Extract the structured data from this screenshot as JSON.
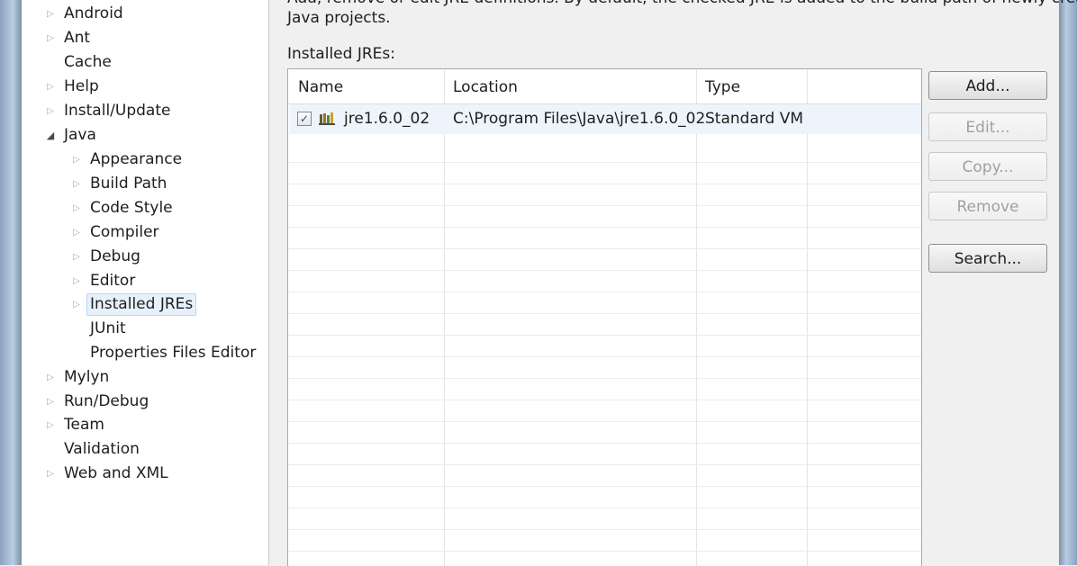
{
  "tree": {
    "items": [
      {
        "label": "Android",
        "expander": "collapsed"
      },
      {
        "label": "Ant",
        "expander": "collapsed"
      },
      {
        "label": "Cache",
        "expander": "none"
      },
      {
        "label": "Help",
        "expander": "collapsed"
      },
      {
        "label": "Install/Update",
        "expander": "collapsed"
      },
      {
        "label": "Java",
        "expander": "expanded"
      },
      {
        "label": "Appearance",
        "expander": "collapsed"
      },
      {
        "label": "Build Path",
        "expander": "collapsed"
      },
      {
        "label": "Code Style",
        "expander": "collapsed"
      },
      {
        "label": "Compiler",
        "expander": "collapsed"
      },
      {
        "label": "Debug",
        "expander": "collapsed"
      },
      {
        "label": "Editor",
        "expander": "collapsed"
      },
      {
        "label": "Installed JREs",
        "expander": "collapsed",
        "selected": true
      },
      {
        "label": "JUnit",
        "expander": "none"
      },
      {
        "label": "Properties Files Editor",
        "expander": "none"
      },
      {
        "label": "Mylyn",
        "expander": "collapsed"
      },
      {
        "label": "Run/Debug",
        "expander": "collapsed"
      },
      {
        "label": "Team",
        "expander": "collapsed"
      },
      {
        "label": "Validation",
        "expander": "none"
      },
      {
        "label": "Web and XML",
        "expander": "collapsed"
      }
    ]
  },
  "page": {
    "description_line1": "Add, remove or edit JRE definitions. By default, the checked JRE is added to the build path of newly created",
    "description_line2": "Java projects.",
    "installed_label": "Installed JREs:"
  },
  "table": {
    "columns": [
      "Name",
      "Location",
      "Type"
    ],
    "rows": [
      {
        "checked": true,
        "name": "jre1.6.0_02",
        "location": "C:\\Program Files\\Java\\jre1.6.0_02",
        "type": "Standard VM"
      }
    ]
  },
  "buttons": {
    "add": "Add...",
    "edit": "Edit...",
    "copy": "Copy...",
    "remove": "Remove",
    "search": "Search..."
  },
  "icons": {
    "checkbox_mark": "✓",
    "expanded": "◢",
    "collapsed": "▷"
  },
  "colors": {
    "selection": "#e8f1fb",
    "window_frame": "#b9cde2"
  }
}
